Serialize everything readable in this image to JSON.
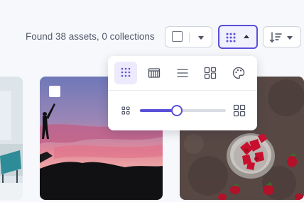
{
  "toolbar": {
    "found_text": "Found 38 assets, 0 collections",
    "select_button": {
      "checked": false
    },
    "view_button": {
      "icon": "grid-dots-icon",
      "open": true
    },
    "sort_button": {
      "icon": "sort-icon"
    }
  },
  "view_menu": {
    "options": [
      {
        "icon": "grid-dots-icon",
        "active": true
      },
      {
        "icon": "filmstrip-icon",
        "active": false
      },
      {
        "icon": "list-icon",
        "active": false
      },
      {
        "icon": "masonry-icon",
        "active": false
      },
      {
        "icon": "palette-icon",
        "active": false
      }
    ],
    "size_slider": {
      "value_fraction": 0.43,
      "min_icon": "small-grid-icon",
      "max_icon": "large-grid-icon"
    }
  },
  "colors": {
    "accent": "#5a4fd8",
    "accent_light": "#eceafc",
    "text": "#545a6b",
    "border": "#cfd3dc"
  }
}
